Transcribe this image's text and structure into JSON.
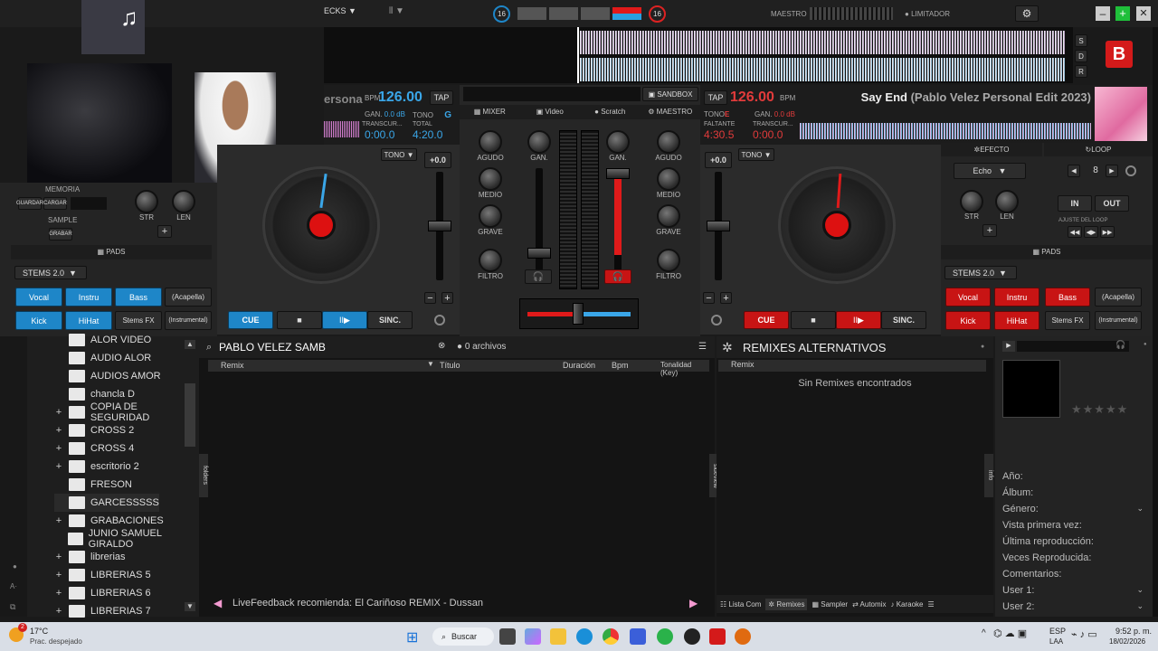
{
  "topbar": {
    "decks": "ECKS",
    "beat_left": "16",
    "beat_right": "16",
    "master": "MAESTRO",
    "limiter": "LIMITADOR"
  },
  "logo": {
    "text": "B"
  },
  "wave_side": [
    "S",
    "D",
    "R"
  ],
  "left_deck": {
    "title_partial": "ersona",
    "bpm_label": "BPM",
    "bpm": "126.00",
    "tap": "TAP",
    "gain_label": "GAN.",
    "gain": "0.0 dB",
    "key_label": "TONO",
    "key": "G",
    "time_label": "TRANSCUR...",
    "elapsed": "0:00.0",
    "total_label": "TOTAL",
    "total": "4:20.0",
    "pitch": "+0.0",
    "tono": "TONO",
    "cue": "CUE",
    "stop": "■",
    "play": "II▶",
    "sync": "SINC."
  },
  "right_deck": {
    "tap": "TAP",
    "bpm": "126.00",
    "bpm_label": "BPM",
    "key_label": "TONO",
    "key": "E",
    "gain_label": "GAN.",
    "gain": "0.0 dB",
    "remain_label": "FALTANTE",
    "remain": "4:30.5",
    "elapsed_label": "TRANSCUR...",
    "elapsed": "0:00.0",
    "title": "Say End",
    "subtitle": "(Pablo Velez Personal Edit 2023)",
    "pitch": "+0.0",
    "tono": "TONO",
    "cue": "CUE",
    "stop": "■",
    "play": "II▶",
    "sync": "SINC."
  },
  "mixer": {
    "sandbox": "SANDBOX",
    "tabs": [
      "MIXER",
      "Video",
      "Scratch",
      "MAESTRO"
    ],
    "eq": [
      "AGUDO",
      "MEDIO",
      "GRAVE",
      "FILTRO"
    ],
    "gain": "GAN."
  },
  "left_panel": {
    "memory": "MEMORIA",
    "save": "GUARDAR",
    "load": "CARGAR",
    "sample": "SAMPLE",
    "record": "GRABAR",
    "str": "STR",
    "len": "LEN",
    "pads": "PADS",
    "stems": "STEMS 2.0",
    "row1": [
      "Vocal",
      "Instru",
      "Bass",
      "(Acapella)"
    ],
    "row2": [
      "Kick",
      "HiHat",
      "Stems FX",
      "(Instrumental)"
    ]
  },
  "right_panel": {
    "effect": "EFECTO",
    "loop": "LOOP",
    "echo": "Echo",
    "loop_val": "8",
    "in": "IN",
    "out": "OUT",
    "loop_adj": "AJUSTE DEL LOOP",
    "str": "STR",
    "len": "LEN",
    "pads": "PADS",
    "stems": "STEMS 2.0",
    "row1": [
      "Vocal",
      "Instru",
      "Bass",
      "(Acapella)"
    ],
    "row2": [
      "Kick",
      "HiHat",
      "Stems FX",
      "(Instrumental)"
    ]
  },
  "folders": [
    {
      "name": "ALOR VIDEO",
      "plus": ""
    },
    {
      "name": "AUDIO ALOR",
      "plus": ""
    },
    {
      "name": "AUDIOS AMOR",
      "plus": ""
    },
    {
      "name": "chancla D",
      "plus": ""
    },
    {
      "name": "COPIA DE SEGURIDAD",
      "plus": "+"
    },
    {
      "name": "CROSS 2",
      "plus": "+"
    },
    {
      "name": "CROSS 4",
      "plus": "+"
    },
    {
      "name": "escritorio 2",
      "plus": "+"
    },
    {
      "name": "FRESON",
      "plus": ""
    },
    {
      "name": "GARCESSSSS",
      "plus": ""
    },
    {
      "name": "GRABACIONES",
      "plus": "+"
    },
    {
      "name": "JUNIO SAMUEL GIRALDO",
      "plus": ""
    },
    {
      "name": "librerias",
      "plus": "+"
    },
    {
      "name": "LIBRERIAS 5",
      "plus": "+"
    },
    {
      "name": "LIBRERIAS 6",
      "plus": "+"
    },
    {
      "name": "LIBRERIAS 7",
      "plus": "+"
    }
  ],
  "browser": {
    "search": "PABLO VELEZ SAMB",
    "count": "0 archivos",
    "cols": [
      "Remix",
      "Título",
      "Duración",
      "Bpm",
      "Tonalidad (Key)"
    ],
    "folders_tab": "folders",
    "sideview": "sideview",
    "feedback": "LiveFeedback recomienda: El Cariñoso REMIX - Dussan"
  },
  "remixes": {
    "title": "REMIXES ALTERNATIVOS",
    "col": "Remix",
    "empty": "Sin Remixes encontrados",
    "tabs": [
      "Lista Com",
      "Remixes",
      "Sampler",
      "Automix",
      "Karaoke"
    ]
  },
  "info": {
    "tab": "info",
    "fields": [
      "Año:",
      "Álbum:",
      "Género:",
      "Vista primera vez:",
      "Última reproducción:",
      "Veces Reproducida:",
      "Comentarios:",
      "User 1:",
      "User 2:"
    ]
  },
  "taskbar": {
    "temp": "17°C",
    "weather": "Prac. despejado",
    "search": "Buscar",
    "lang1": "ESP",
    "lang2": "LAA",
    "time": "9:52 p. m.",
    "date": "18/02/2026",
    "badge": "2"
  }
}
